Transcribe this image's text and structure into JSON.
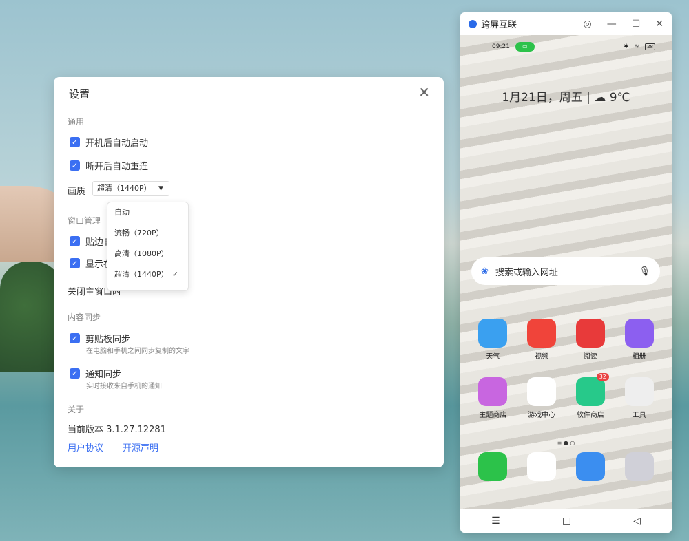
{
  "settings": {
    "title": "设置",
    "close": "✕",
    "general": "通用",
    "autostart": "开机后自动启动",
    "reconnect": "断开后自动重连",
    "quality_label": "画质",
    "quality_value": "超清（1440P）",
    "quality_options": [
      "自动",
      "流畅（720P）",
      "高清（1080P）",
      "超清（1440P）"
    ],
    "window": "窗口管理",
    "snap": "贴边自",
    "show": "显示在",
    "close_main": "关闭主窗口时",
    "sync": "内容同步",
    "clipboard": "剪贴板同步",
    "clipboard_desc": "在电脑和手机之间同步复制的文字",
    "notify": "通知同步",
    "notify_desc": "实时接收来自手机的通知",
    "about": "关于",
    "version": "当前版本 3.1.27.12281",
    "agreement": "用户协议",
    "opensource": "开源声明"
  },
  "phone": {
    "title": "跨屏互联",
    "time": "09:21",
    "battery": "28",
    "date": "1月21日，周五",
    "temp": "9℃",
    "search": "搜索或输入网址",
    "apps": [
      {
        "label": "天气",
        "color": "#3aa0f0"
      },
      {
        "label": "视频",
        "color": "#f0443a"
      },
      {
        "label": "阅读",
        "color": "#e83a3a"
      },
      {
        "label": "相册",
        "color": "#8c5ff0"
      },
      {
        "label": "主题商店",
        "color": "#c866e0"
      },
      {
        "label": "游戏中心",
        "color": "#ffffff"
      },
      {
        "label": "软件商店",
        "color": "#27c98a",
        "badge": "32"
      },
      {
        "label": "工具",
        "color": "#eeeeee"
      }
    ],
    "dock": [
      {
        "name": "phone",
        "color": "#2cc24a"
      },
      {
        "name": "messages",
        "color": "#ffffff"
      },
      {
        "name": "browser",
        "color": "#3b8ef0"
      },
      {
        "name": "camera",
        "color": "#d0d0d8"
      }
    ]
  }
}
